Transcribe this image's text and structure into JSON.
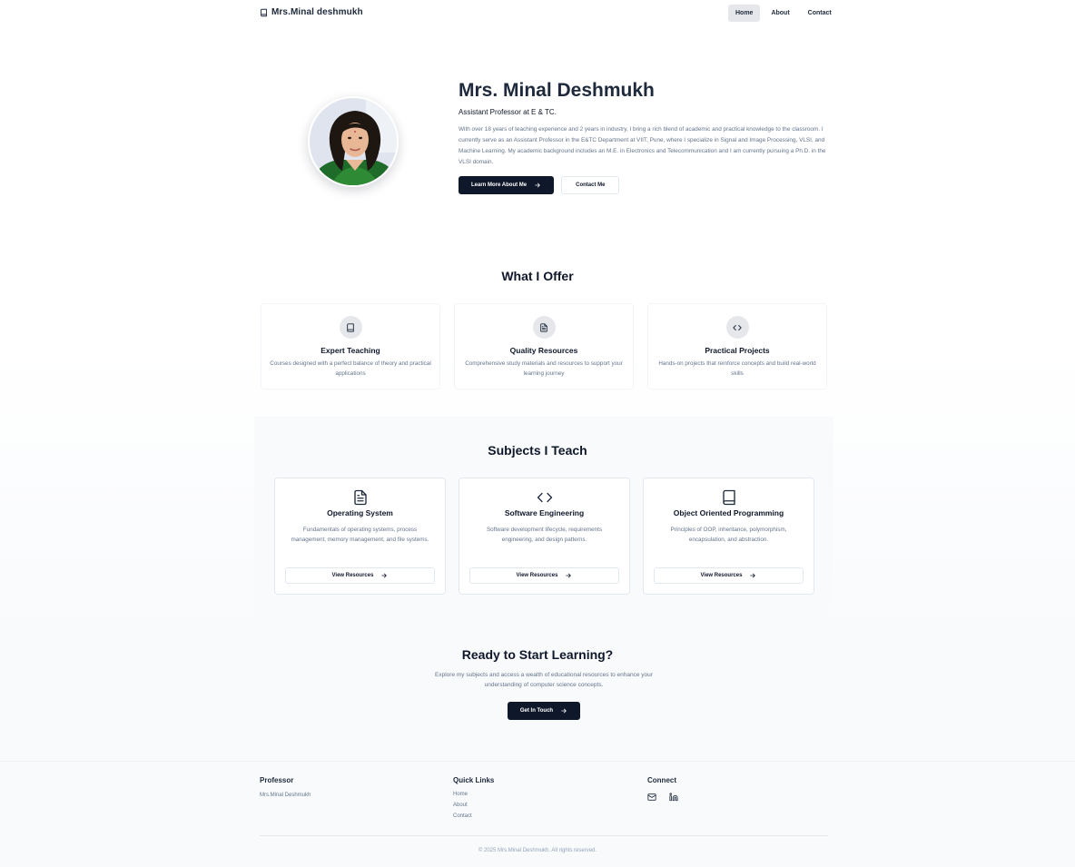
{
  "brand": {
    "name": "Mrs.Minal deshmukh",
    "icon": "book-icon"
  },
  "nav": {
    "items": [
      {
        "label": "Home",
        "active": true
      },
      {
        "label": "About",
        "active": false
      },
      {
        "label": "Contact",
        "active": false
      }
    ]
  },
  "hero": {
    "name": "Mrs. Minal Deshmukh",
    "role": "Assistant Professor at E & TC.",
    "bio": "With over 18 years of teaching experience and 2 years in industry, I bring a rich blend of academic and practical knowledge to the classroom. I currently serve as an Assistant Professor in the E&TC Department at VIIT, Pune, where I specialize in Signal and Image Processing, VLSI, and Machine Learning. My academic background includes an M.E. in Electronics and Telecommunication and I am currently pursuing a Ph.D. in the VLSI domain.",
    "primary_button": "Learn More About Me",
    "secondary_button": "Contact Me"
  },
  "offer": {
    "title": "What I Offer",
    "items": [
      {
        "title": "Expert Teaching",
        "desc": "Courses designed with a perfect balance of theory and practical applications",
        "icon": "book-icon"
      },
      {
        "title": "Quality Resources",
        "desc": "Comprehensive study materials and resources to support your learning journey",
        "icon": "file-text-icon"
      },
      {
        "title": "Practical Projects",
        "desc": "Hands-on projects that reinforce concepts and build real-world skills",
        "icon": "code-icon"
      }
    ]
  },
  "subjects": {
    "title": "Subjects I Teach",
    "items": [
      {
        "title": "Operating System",
        "desc": "Fundamentals of operating systems, process management, memory management, and file systems.",
        "button": "View Resources",
        "icon": "file-text-icon"
      },
      {
        "title": "Software Engineering",
        "desc": "Software development lifecycle, requirements engineering, and design patterns.",
        "button": "View Resources",
        "icon": "code-icon"
      },
      {
        "title": "Object Oriented Programming",
        "desc": "Principles of OOP, inheritance, polymorphism, encapsulation, and abstraction.",
        "button": "View Resources",
        "icon": "book-icon"
      }
    ]
  },
  "cta": {
    "title": "Ready to Start Learning?",
    "desc": "Explore my subjects and access a wealth of educational resources to enhance your understanding of computer science concepts.",
    "button": "Get In Touch"
  },
  "footer": {
    "professor_heading": "Professor",
    "professor_name": "Mrs.Minal Deshmukh",
    "links_heading": "Quick Links",
    "links": [
      "Home",
      "About",
      "Contact"
    ],
    "connect_heading": "Connect",
    "social_icons": [
      "mail-icon",
      "linkedin-icon"
    ],
    "copyright": "© 2025 Mrs.Minal Deshmukh. All rights reserved."
  },
  "colors": {
    "primary": "#0f172a",
    "muted_text": "#64748b",
    "border": "#e2e8f0",
    "active_nav_bg": "#e5e7eb"
  }
}
